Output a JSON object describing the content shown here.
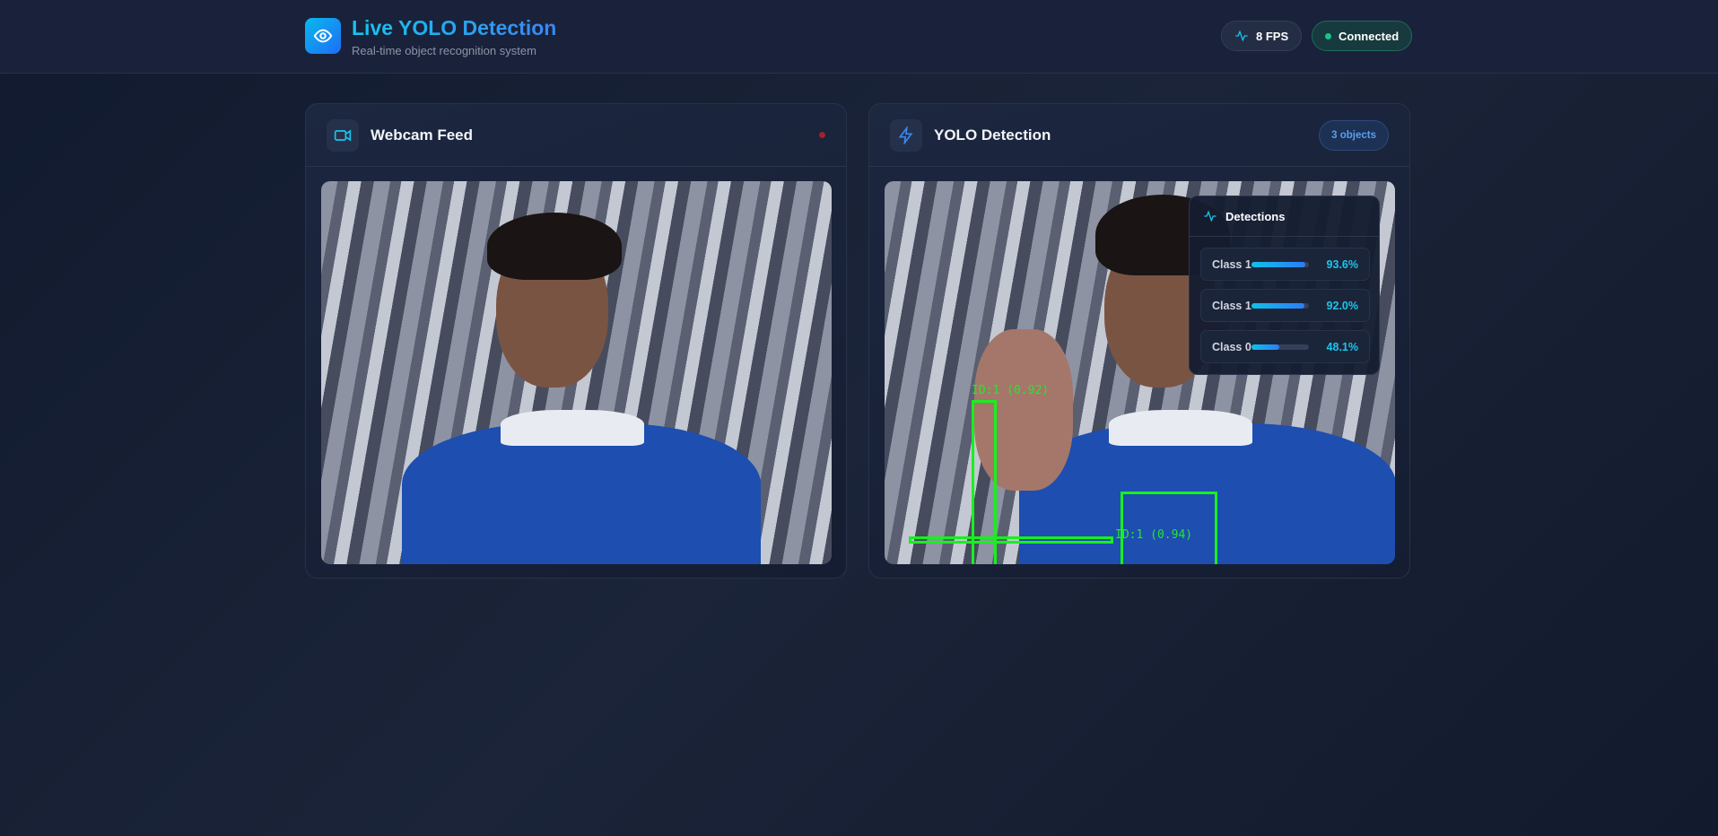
{
  "header": {
    "title": "Live YOLO Detection",
    "subtitle": "Real-time object recognition system",
    "fps": "8 FPS",
    "status": "Connected"
  },
  "webcam": {
    "title": "Webcam Feed"
  },
  "yolo": {
    "title": "YOLO Detection",
    "count": "3 objects",
    "box_labels": [
      "ID:1  (0.92)",
      "ID:1  (0.94)"
    ],
    "panel_title": "Detections",
    "detections": [
      {
        "label": "Class 1",
        "confidence": "93.6%",
        "value": 0.936
      },
      {
        "label": "Class 1",
        "confidence": "92.0%",
        "value": 0.92
      },
      {
        "label": "Class 0",
        "confidence": "48.1%",
        "value": 0.481
      }
    ]
  },
  "colors": {
    "accent": "#16c6ee",
    "box": "#18f01e",
    "connected": "#19c48a",
    "recording": "#a3202e"
  }
}
